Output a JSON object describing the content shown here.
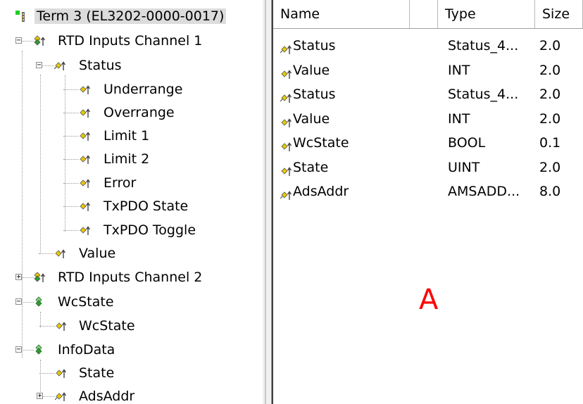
{
  "tree": {
    "items": [
      {
        "label": "Term 3 (EL3202-0000-0017)",
        "icon": "terminal-icon",
        "expander": "",
        "selected": true
      },
      {
        "label": "RTD Inputs Channel 1",
        "icon": "input-group-icon",
        "expander": "−"
      },
      {
        "label": "Status",
        "icon": "status-variable-icon",
        "expander": "−"
      },
      {
        "label": "Underrange",
        "icon": "input-variable-icon",
        "expander": ""
      },
      {
        "label": "Overrange",
        "icon": "input-variable-icon",
        "expander": ""
      },
      {
        "label": "Limit 1",
        "icon": "input-variable-icon",
        "expander": ""
      },
      {
        "label": "Limit 2",
        "icon": "input-variable-icon",
        "expander": ""
      },
      {
        "label": "Error",
        "icon": "input-variable-icon",
        "expander": ""
      },
      {
        "label": "TxPDO State",
        "icon": "input-variable-icon",
        "expander": ""
      },
      {
        "label": "TxPDO Toggle",
        "icon": "input-variable-icon",
        "expander": ""
      },
      {
        "label": "Value",
        "icon": "input-variable-icon",
        "expander": ""
      },
      {
        "label": "RTD Inputs Channel 2",
        "icon": "input-group-icon",
        "expander": "+"
      },
      {
        "label": "WcState",
        "icon": "green-group-icon",
        "expander": "−"
      },
      {
        "label": "WcState",
        "icon": "input-variable-icon",
        "expander": ""
      },
      {
        "label": "InfoData",
        "icon": "green-group-icon",
        "expander": "−"
      },
      {
        "label": "State",
        "icon": "input-variable-icon",
        "expander": ""
      },
      {
        "label": "AdsAddr",
        "icon": "status-variable-icon",
        "expander": "+"
      }
    ]
  },
  "list": {
    "columns": [
      "Name",
      "",
      "Type",
      "Size"
    ],
    "rows": [
      {
        "name": "Status",
        "type": "Status_4...",
        "size": "2.0",
        "icon": "status-variable-icon"
      },
      {
        "name": "Value",
        "type": "INT",
        "size": "2.0",
        "icon": "input-variable-icon"
      },
      {
        "name": "Status",
        "type": "Status_4...",
        "size": "2.0",
        "icon": "status-variable-icon"
      },
      {
        "name": "Value",
        "type": "INT",
        "size": "2.0",
        "icon": "input-variable-icon"
      },
      {
        "name": "WcState",
        "type": "BOOL",
        "size": "0.1",
        "icon": "input-variable-icon"
      },
      {
        "name": "State",
        "type": "UINT",
        "size": "2.0",
        "icon": "input-variable-icon"
      },
      {
        "name": "AdsAddr",
        "type": "AMSADD...",
        "size": "8.0",
        "icon": "status-variable-icon"
      }
    ],
    "annotation": "A",
    "annotation_color": "#ff0000"
  },
  "colors": {
    "icon_yellow": "#e8c800",
    "icon_green": "#2e9a2e",
    "terminal_green": "#22cc22"
  }
}
